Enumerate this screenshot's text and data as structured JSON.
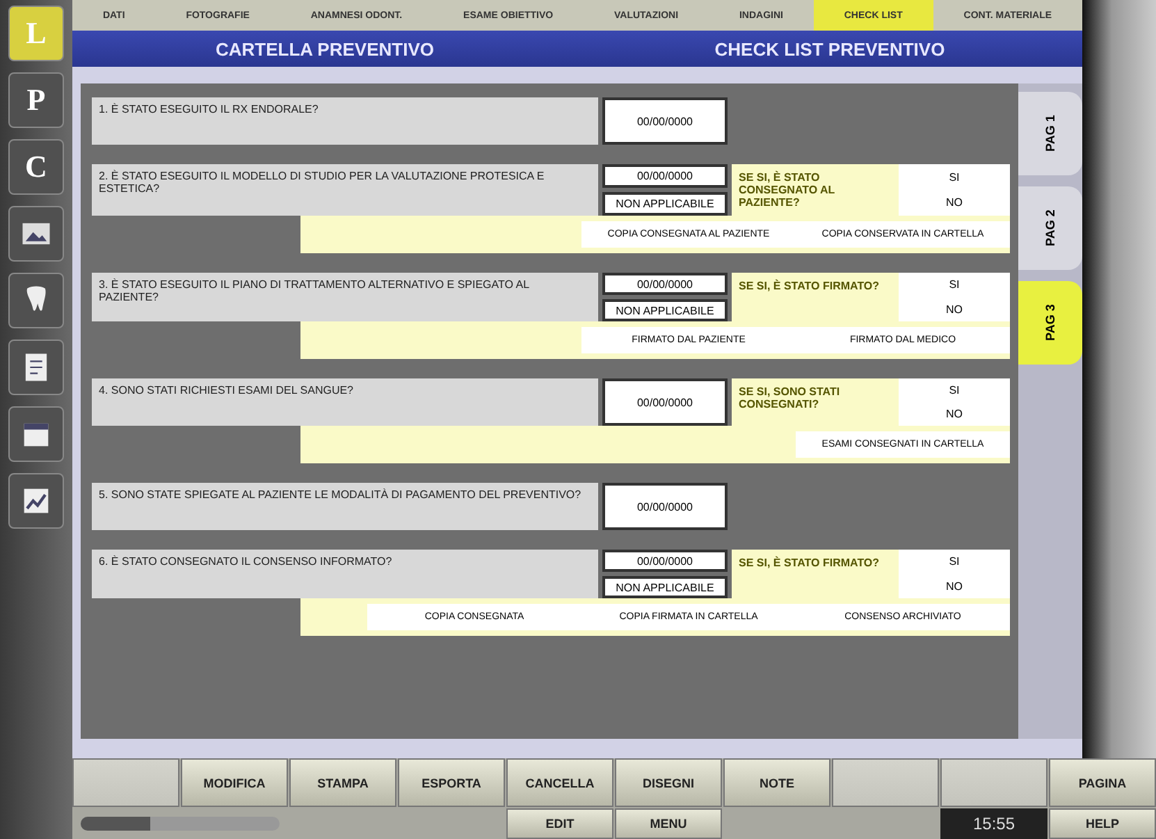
{
  "menu": [
    {
      "label": "DATI",
      "selected": false
    },
    {
      "label": "FOTOGRAFIE",
      "selected": false
    },
    {
      "label": "ANAMNESI ODONT.",
      "selected": false
    },
    {
      "label": "ESAME OBIETTIVO",
      "selected": false
    },
    {
      "label": "VALUTAZIONI",
      "selected": false
    },
    {
      "label": "INDAGINI",
      "selected": false
    },
    {
      "label": "CHECK LIST",
      "selected": true
    },
    {
      "label": "CONT. MATERIALE",
      "selected": false
    }
  ],
  "header": {
    "left": "CARTELLA PREVENTIVO",
    "right": "CHECK LIST PREVENTIVO"
  },
  "sidebar": [
    {
      "kind": "letter",
      "label": "L"
    },
    {
      "kind": "letter",
      "label": "P"
    },
    {
      "kind": "letter",
      "label": "C"
    },
    {
      "kind": "icon"
    },
    {
      "kind": "icon"
    },
    {
      "kind": "icon"
    },
    {
      "kind": "icon"
    },
    {
      "kind": "icon"
    }
  ],
  "questions": [
    {
      "text": "1. È STATO ESEGUITO IL RX ENDORALE?",
      "boxes": [
        "00/00/0000"
      ]
    },
    {
      "text": "2. È STATO ESEGUITO IL MODELLO DI STUDIO PER LA VALUTAZIONE PROTESICA E ESTETICA?",
      "boxes": [
        "00/00/0000",
        "NON APPLICABILE"
      ],
      "side": {
        "text": "SE SI, È STATO CONSEGNATO AL PAZIENTE?",
        "options": [
          "SI",
          "NO"
        ]
      },
      "notes": [
        "COPIA CONSEGNATA AL PAZIENTE",
        "COPIA CONSERVATA IN CARTELLA"
      ]
    },
    {
      "text": "3. È STATO ESEGUITO IL PIANO DI TRATTAMENTO ALTERNATIVO E SPIEGATO AL PAZIENTE?",
      "boxes": [
        "00/00/0000",
        "NON APPLICABILE"
      ],
      "side": {
        "text": "SE SI, È STATO FIRMATO?",
        "options": [
          "SI",
          "NO"
        ]
      },
      "notes": [
        "FIRMATO DAL PAZIENTE",
        "FIRMATO DAL MEDICO"
      ]
    },
    {
      "text": "4. SONO STATI RICHIESTI ESAMI DEL SANGUE?",
      "boxes": [
        "00/00/0000"
      ],
      "side": {
        "text": "SE SI, SONO STATI CONSEGNATI?",
        "options": [
          "SI",
          "NO"
        ]
      },
      "notes": [
        "ESAMI CONSEGNATI IN CARTELLA"
      ]
    },
    {
      "text": "5. SONO STATE SPIEGATE AL PAZIENTE LE MODALITÀ DI PAGAMENTO DEL PREVENTIVO?",
      "boxes": [
        "00/00/0000"
      ]
    },
    {
      "text": "6. È STATO CONSEGNATO IL CONSENSO INFORMATO?",
      "boxes": [
        "00/00/0000",
        "NON APPLICABILE"
      ],
      "side": {
        "text": "SE SI, È STATO FIRMATO?",
        "options": [
          "SI",
          "NO"
        ]
      },
      "notes": [
        "COPIA CONSEGNATA",
        "COPIA FIRMATA IN CARTELLA",
        "CONSENSO ARCHIVIATO"
      ]
    }
  ],
  "tabs": [
    {
      "label": "PAG 1",
      "selected": false
    },
    {
      "label": "PAG 2",
      "selected": false
    },
    {
      "label": "PAG 3",
      "selected": true
    }
  ],
  "toolbar": [
    {
      "enabled": false
    },
    {
      "label": "MODIFICA",
      "enabled": true
    },
    {
      "label": "STAMPA",
      "enabled": true
    },
    {
      "label": "ESPORTA",
      "enabled": true
    },
    {
      "label": "CANCELLA",
      "enabled": true
    },
    {
      "label": "DISEGNI",
      "enabled": true
    },
    {
      "label": "NOTE",
      "enabled": true
    },
    {
      "enabled": false
    },
    {
      "enabled": false
    },
    {
      "label": "PAGINA",
      "enabled": true
    }
  ],
  "status": {
    "progress": {
      "level": 0.35
    },
    "edit": "EDIT",
    "menu": "MENU",
    "clock": "15:55",
    "help": "HELP"
  }
}
